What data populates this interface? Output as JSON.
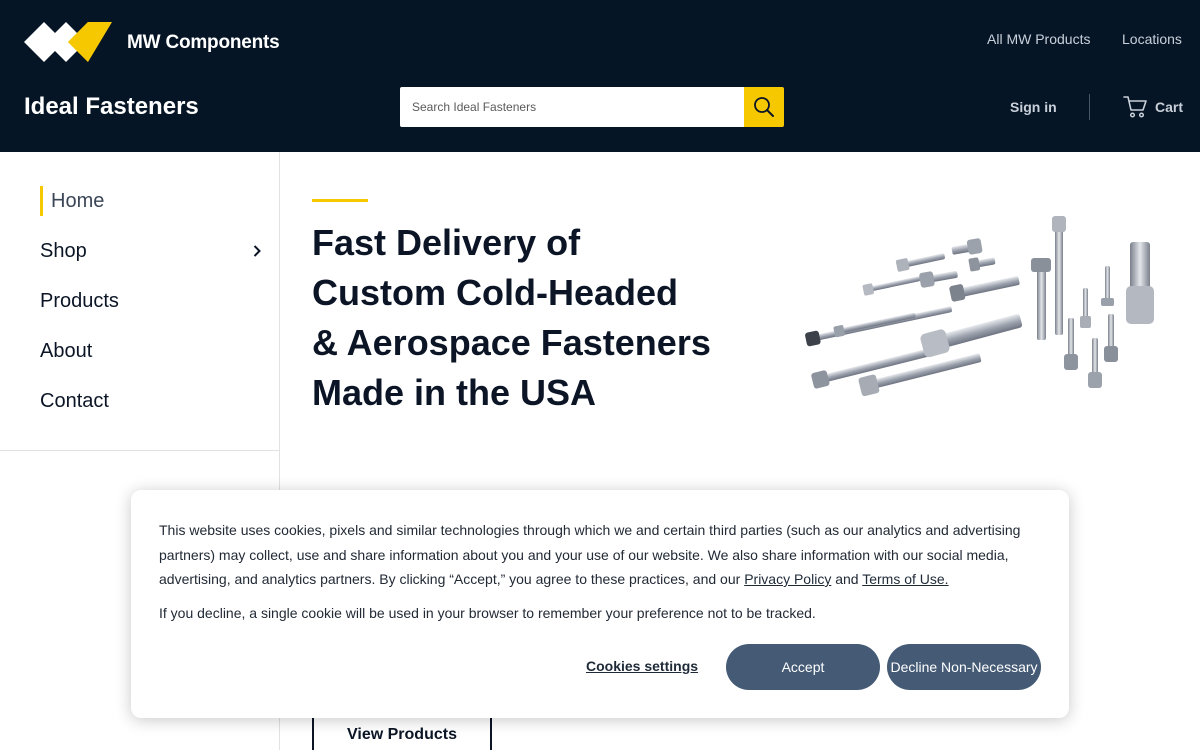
{
  "header": {
    "logo_text": "MW Components",
    "logo_icon": "mw-logo-icon",
    "top_links": [
      "All MW Products",
      "Locations"
    ],
    "site_name": "Ideal Fasteners",
    "search": {
      "placeholder": "Search Ideal Fasteners",
      "value": "",
      "icon": "search-icon"
    },
    "sign_in": "Sign in",
    "cart": {
      "label": "Cart",
      "icon": "cart-icon"
    }
  },
  "sidebar": {
    "items": [
      {
        "label": "Home",
        "active": true
      },
      {
        "label": "Shop",
        "has_submenu": true
      },
      {
        "label": "Products"
      },
      {
        "label": "About"
      },
      {
        "label": "Contact"
      }
    ]
  },
  "hero": {
    "title": "Fast Delivery of Custom Cold-Headed & Aerospace Fasteners Made in the USA",
    "cta": "View Products"
  },
  "cookie_banner": {
    "text_before_links": "This website uses cookies, pixels and similar technologies through which we and certain third parties (such as our analytics and advertising partners) may collect, use and share information about you and your use of our website. We also share information with our social media, advertising, and analytics partners. By clicking “Accept,” you agree to these practices, and our ",
    "privacy_link": "Privacy Policy",
    "and_text": " and ",
    "terms_link": "Terms of Use.",
    "decline_note": "If you decline, a single cookie will be used in your browser to remember your preference not to be tracked.",
    "settings_label": "Cookies settings",
    "accept_label": "Accept",
    "decline_label": "Decline Non-Necessary"
  },
  "colors": {
    "header_bg": "#051526",
    "accent_yellow": "#f5c800",
    "button_slate": "#445a75",
    "text_dark": "#0b1526"
  }
}
